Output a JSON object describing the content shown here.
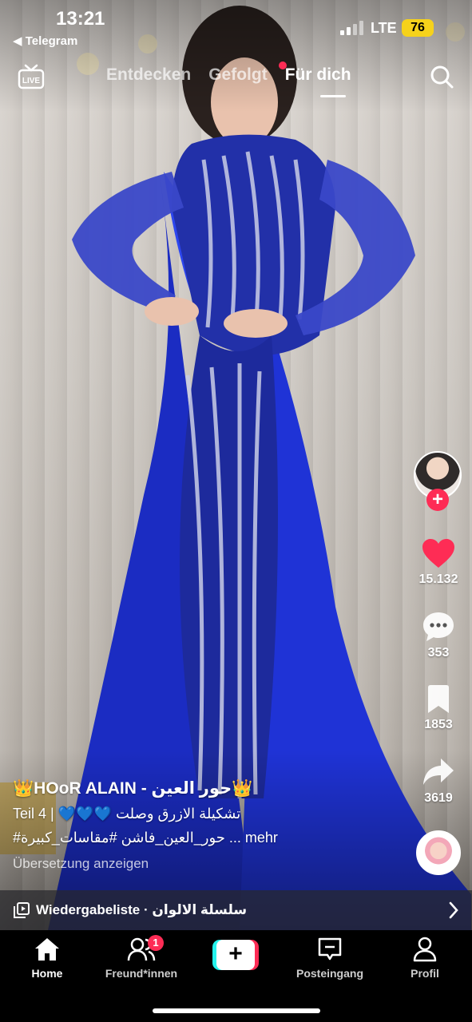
{
  "status_bar": {
    "time": "13:21",
    "back_app": "◀ Telegram",
    "network": "LTE",
    "battery": "76"
  },
  "top_nav": {
    "live_icon": "live-tv-icon",
    "tabs": [
      {
        "label": "Entdecken",
        "active": false
      },
      {
        "label": "Gefolgt",
        "active": false,
        "has_dot": true
      },
      {
        "label": "Für dich",
        "active": true
      }
    ],
    "search_icon": "search-icon"
  },
  "right_rail": {
    "likes": "15.132",
    "comments": "353",
    "bookmarks": "1853",
    "shares": "3619"
  },
  "caption": {
    "author": "👑HOoR ALAIN - حور العين👑",
    "line1": "Teil 4 | 💙💙💙 تشكيلة الازرق وصلت",
    "line2": "#حور_العين_فاشن #مقاسات_كبيرة ... mehr",
    "translate": "Übersetzung anzeigen"
  },
  "playlist": {
    "label": "Wiedergabeliste · سلسلة الالوان"
  },
  "bottom_nav": {
    "items": [
      {
        "label": "Home",
        "icon": "home-icon",
        "active": true
      },
      {
        "label": "Freund*innen",
        "icon": "friends-icon",
        "badge": "1"
      },
      {
        "label": "+",
        "icon": "create-icon"
      },
      {
        "label": "Posteingang",
        "icon": "inbox-icon"
      },
      {
        "label": "Profil",
        "icon": "profile-icon"
      }
    ]
  },
  "colors": {
    "accent": "#fe2c55",
    "cyan": "#25f4ee",
    "battery": "#f6d21b",
    "dress": "#1f2fc4"
  }
}
